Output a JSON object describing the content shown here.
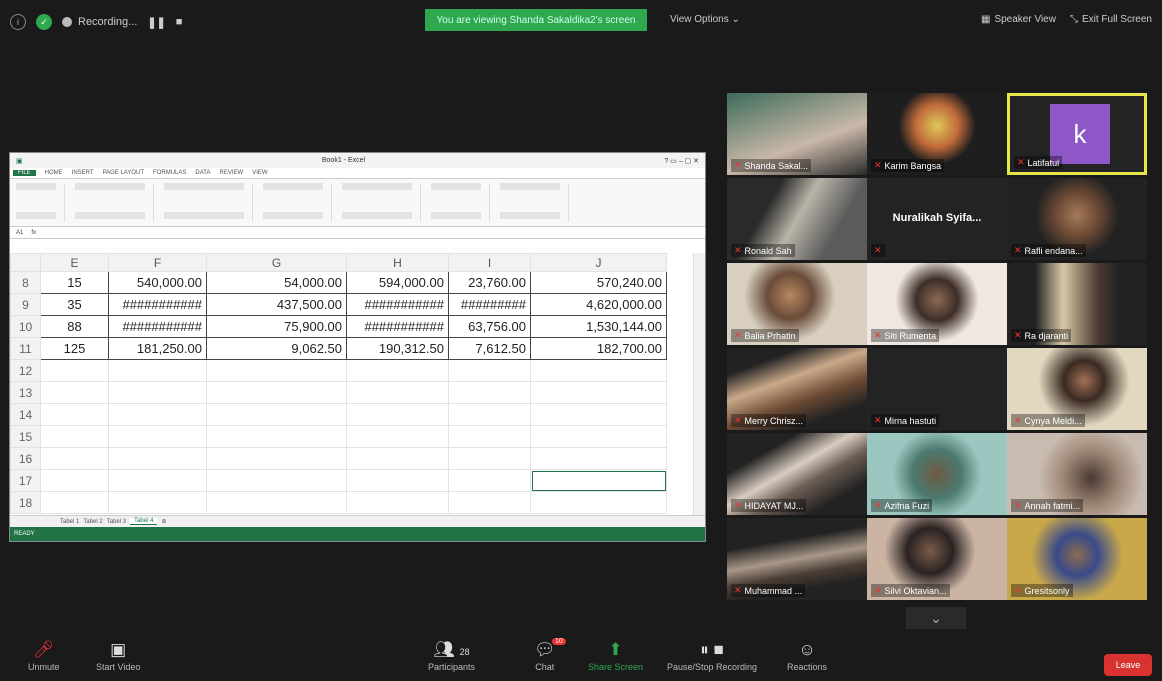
{
  "topbar": {
    "recording": "Recording...",
    "banner": "You are viewing Shanda Sakaldika2's screen",
    "view_options": "View Options ⌄",
    "speaker_view": "Speaker View",
    "exit_full_screen": "Exit Full Screen"
  },
  "excel": {
    "title": "Book1 - Excel",
    "tabs": [
      "FILE",
      "HOME",
      "INSERT",
      "PAGE LAYOUT",
      "FORMULAS",
      "DATA",
      "REVIEW",
      "VIEW"
    ],
    "name_box": "A1",
    "columns": [
      "E",
      "F",
      "G",
      "H",
      "I",
      "J"
    ],
    "rows": [
      {
        "n": "8",
        "e": "15",
        "f": "540,000.00",
        "g": "54,000.00",
        "h": "594,000.00",
        "i": "23,760.00",
        "j": "570,240.00"
      },
      {
        "n": "9",
        "e": "35",
        "f": "###########",
        "g": "437,500.00",
        "h": "###########",
        "i": "#########",
        "j": "4,620,000.00"
      },
      {
        "n": "10",
        "e": "88",
        "f": "###########",
        "g": "75,900.00",
        "h": "###########",
        "i": "63,756.00",
        "j": "1,530,144.00"
      },
      {
        "n": "11",
        "e": "125",
        "f": "181,250.00",
        "g": "9,062.50",
        "h": "190,312.50",
        "i": "7,612.50",
        "j": "182,700.00"
      }
    ],
    "empty_rows": [
      "12",
      "13",
      "14",
      "15",
      "16",
      "17",
      "18"
    ],
    "sheets": [
      "Tabel 1",
      "Tabel 2",
      "Tabel 3",
      "Tabel 4"
    ],
    "status": "READY"
  },
  "participants": [
    {
      "name": "Shanda Sakal..."
    },
    {
      "name": "Karim Bangsa"
    },
    {
      "name": "Latifatul"
    },
    {
      "name": "Ronald Sah"
    },
    {
      "name": "Nuralikah Syifa..."
    },
    {
      "name": "Rafli endana..."
    },
    {
      "name": "Balia Prhatin"
    },
    {
      "name": "Siti Rumenta"
    },
    {
      "name": "Ra djaranti"
    },
    {
      "name": "Merry Chrisz..."
    },
    {
      "name": "Mirna hastuti"
    },
    {
      "name": "Cynya Meldi..."
    },
    {
      "name": "HIDAYAT MJ..."
    },
    {
      "name": "Azifna Fuzi"
    },
    {
      "name": "Annah fatmi..."
    },
    {
      "name": "Muhammad ..."
    },
    {
      "name": "Silvi Oktavian..."
    },
    {
      "name": "Gresitsonly"
    }
  ],
  "bottombar": {
    "unmute": "Unmute",
    "start_video": "Start Video",
    "participants": "Participants",
    "participants_count": "28",
    "chat": "Chat",
    "chat_badge": "10",
    "share_screen": "Share Screen",
    "pause_recording": "Pause/Stop Recording",
    "reactions": "Reactions",
    "leave": "Leave"
  },
  "colors": {
    "banner": "#2fa84f",
    "leave": "#d9332f",
    "excel_green": "#217346",
    "active_tile": "#e6e64a"
  }
}
